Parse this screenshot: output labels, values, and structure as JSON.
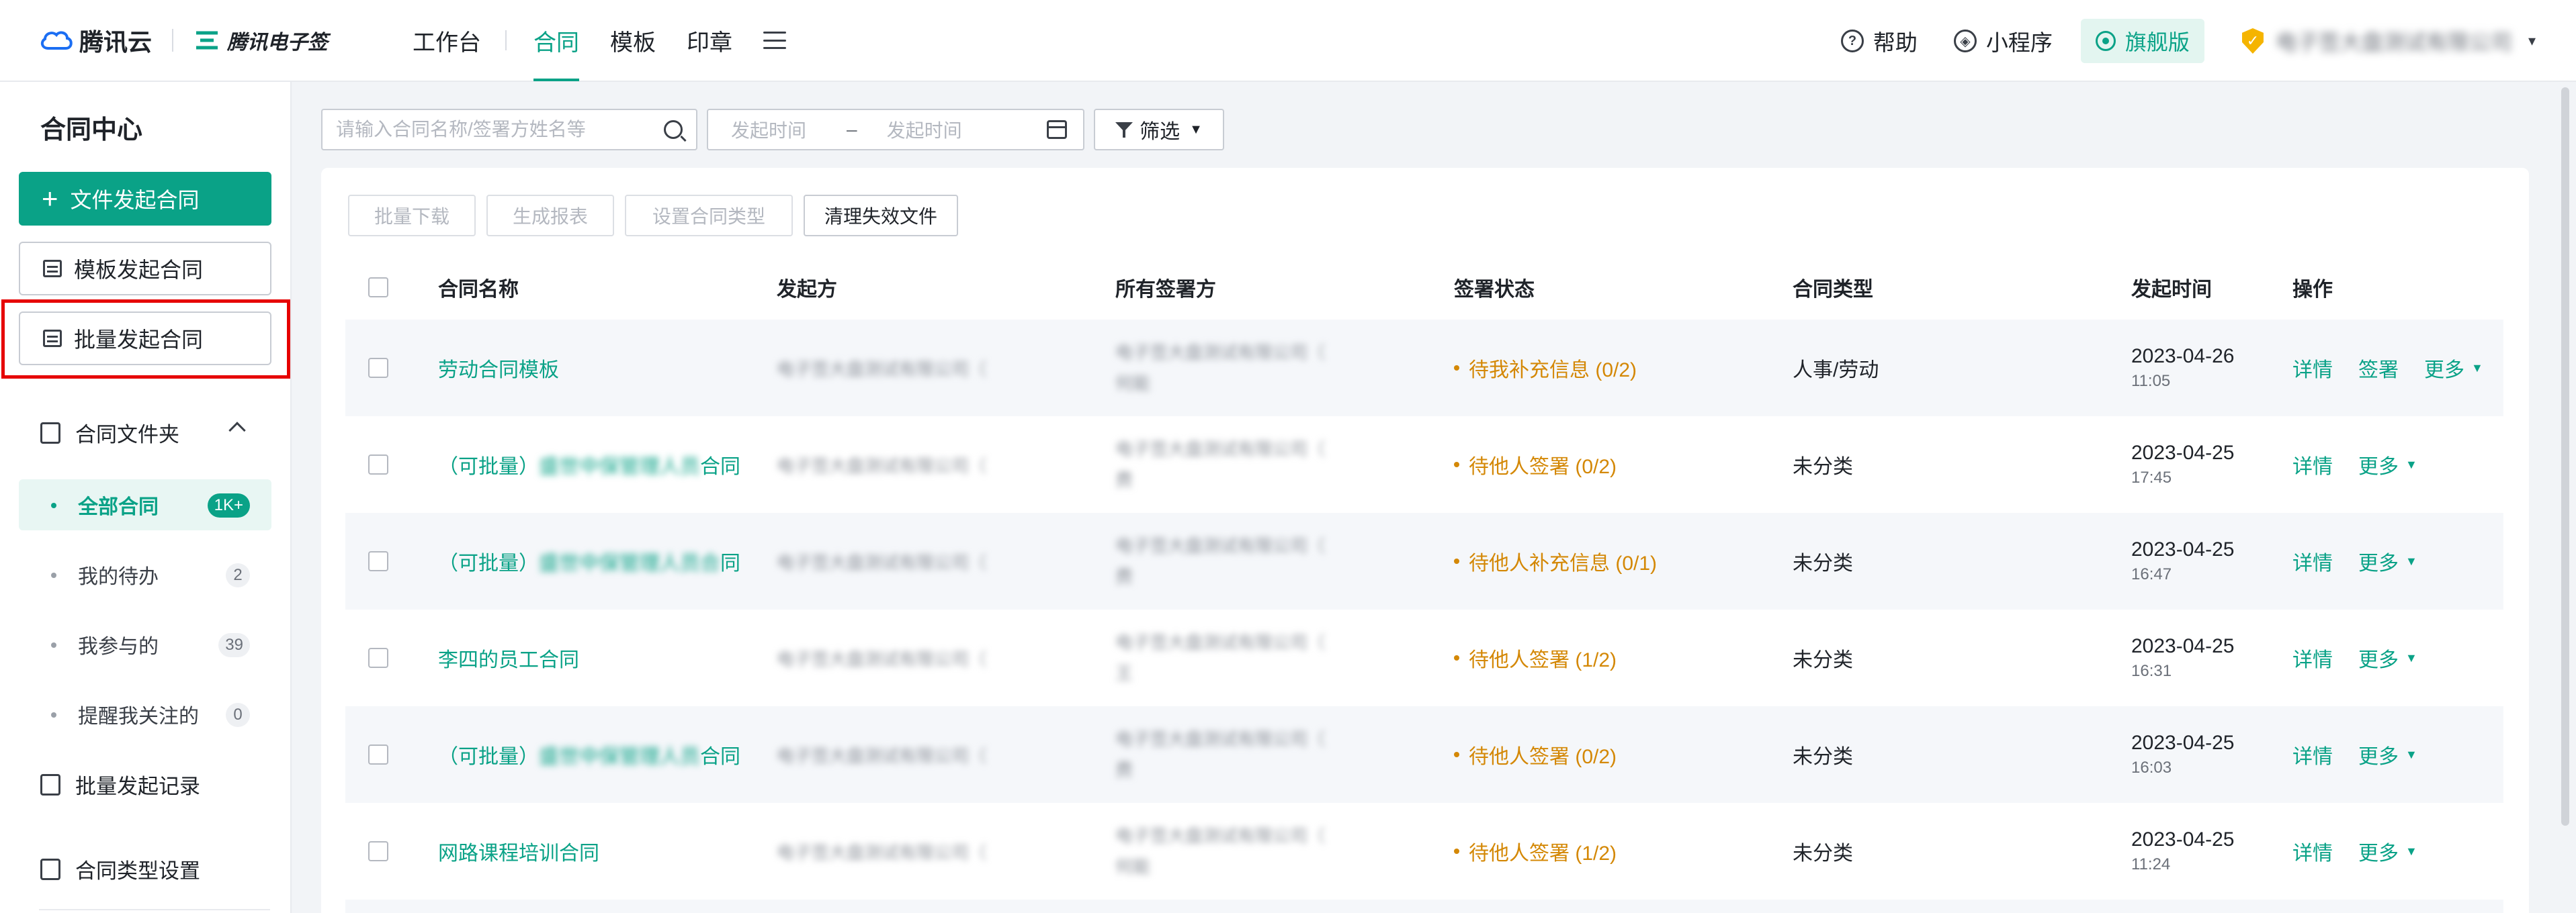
{
  "header": {
    "brand_cloud": "腾讯云",
    "brand_esign": "腾讯电子签",
    "nav": [
      {
        "label": "工作台",
        "active": false
      },
      {
        "label": "合同",
        "active": true
      },
      {
        "label": "模板",
        "active": false
      },
      {
        "label": "印章",
        "active": false
      }
    ],
    "help_label": "帮助",
    "miniapp_label": "小程序",
    "edition_label": "旗舰版",
    "account_name": "电子签大盘测试有限公司"
  },
  "sidebar": {
    "title": "合同中心",
    "file_start_label": "文件发起合同",
    "template_start_label": "模板发起合同",
    "batch_start_label": "批量发起合同",
    "folder_label": "合同文件夹",
    "items": [
      {
        "label": "全部合同",
        "count": "1K+",
        "active": true
      },
      {
        "label": "我的待办",
        "count": "2",
        "active": false
      },
      {
        "label": "我参与的",
        "count": "39",
        "active": false
      },
      {
        "label": "提醒我关注的",
        "count": "0",
        "active": false
      }
    ],
    "batch_records_label": "批量发起记录",
    "type_settings_label": "合同类型设置"
  },
  "filters": {
    "search_placeholder": "请输入合同名称/签署方姓名等",
    "date_start_placeholder": "发起时间",
    "date_sep": "–",
    "date_end_placeholder": "发起时间",
    "filter_label": "筛选"
  },
  "actions": {
    "batch_download": "批量下载",
    "generate_report": "生成报表",
    "set_type": "设置合同类型",
    "clear_invalid": "清理失效文件"
  },
  "table": {
    "headers": {
      "name": "合同名称",
      "initiator": "发起方",
      "signers": "所有签署方",
      "status": "签署状态",
      "type": "合同类型",
      "time": "发起时间",
      "ops": "操作"
    },
    "rows": [
      {
        "name_prefix": "",
        "name_hidden": "",
        "name_suffix": "劳动合同模板",
        "initiator": "电子签大盘测试有限公司（",
        "signers_line1": "电子签大盘测试有限公司（",
        "signers_line2": "何能",
        "status": "待我补充信息 (0/2)",
        "type": "人事/劳动",
        "date": "2023-04-26",
        "clock": "11:05",
        "op1": "详情",
        "op2": "签署",
        "more": "更多"
      },
      {
        "name_prefix": "（可批量）",
        "name_hidden": "盛世中保管理人员",
        "name_suffix": "合同",
        "initiator": "电子签大盘测试有限公司（",
        "signers_line1": "电子签大盘测试有限公司（",
        "signers_line2": "费",
        "status": "待他人签署 (0/2)",
        "type": "未分类",
        "date": "2023-04-25",
        "clock": "17:45",
        "op1": "详情",
        "op2": "",
        "more": "更多"
      },
      {
        "name_prefix": "（可批量）",
        "name_hidden": "盛世中保管理人员合",
        "name_suffix": "同",
        "initiator": "电子签大盘测试有限公司（",
        "signers_line1": "电子签大盘测试有限公司（",
        "signers_line2": "费",
        "status": "待他人补充信息 (0/1)",
        "type": "未分类",
        "date": "2023-04-25",
        "clock": "16:47",
        "op1": "详情",
        "op2": "",
        "more": "更多"
      },
      {
        "name_prefix": "",
        "name_hidden": "",
        "name_suffix": "李四的员工合同",
        "initiator": "电子签大盘测试有限公司（",
        "signers_line1": "电子签大盘测试有限公司（",
        "signers_line2": "王",
        "status": "待他人签署 (1/2)",
        "type": "未分类",
        "date": "2023-04-25",
        "clock": "16:31",
        "op1": "详情",
        "op2": "",
        "more": "更多"
      },
      {
        "name_prefix": "（可批量）",
        "name_hidden": "盛世中保管理人员",
        "name_suffix": "合同",
        "initiator": "电子签大盘测试有限公司（",
        "signers_line1": "电子签大盘测试有限公司（",
        "signers_line2": "费",
        "status": "待他人签署 (0/2)",
        "type": "未分类",
        "date": "2023-04-25",
        "clock": "16:03",
        "op1": "详情",
        "op2": "",
        "more": "更多"
      },
      {
        "name_prefix": "",
        "name_hidden": "",
        "name_suffix": "网路课程培训合同",
        "initiator": "电子签大盘测试有限公司（",
        "signers_line1": "电子签大盘测试有限公司（",
        "signers_line2": "何能",
        "status": "待他人签署 (1/2)",
        "type": "未分类",
        "date": "2023-04-25",
        "clock": "11:24",
        "op1": "详情",
        "op2": "",
        "more": "更多"
      }
    ]
  },
  "colors": {
    "accent": "#0aa287",
    "warning": "#d48806",
    "highlight": "#e60000"
  }
}
